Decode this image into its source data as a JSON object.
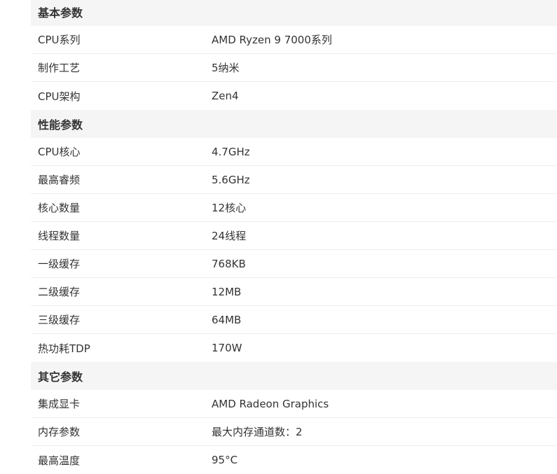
{
  "sections": [
    {
      "title": "基本参数",
      "rows": [
        {
          "label": "CPU系列",
          "value": "AMD Ryzen 9 7000系列"
        },
        {
          "label": "制作工艺",
          "value": "5纳米"
        },
        {
          "label": "CPU架构",
          "value": "Zen4"
        }
      ]
    },
    {
      "title": "性能参数",
      "rows": [
        {
          "label": "CPU核心",
          "value": "4.7GHz"
        },
        {
          "label": "最高睿频",
          "value": "5.6GHz"
        },
        {
          "label": "核心数量",
          "value": "12核心"
        },
        {
          "label": "线程数量",
          "value": "24线程"
        },
        {
          "label": "一级缓存",
          "value": "768KB"
        },
        {
          "label": "二级缓存",
          "value": "12MB"
        },
        {
          "label": "三级缓存",
          "value": "64MB"
        },
        {
          "label": "热功耗TDP",
          "value": "170W"
        }
      ]
    },
    {
      "title": "其它参数",
      "rows": [
        {
          "label": "集成显卡",
          "value": "AMD Radeon Graphics"
        },
        {
          "label": "内存参数",
          "value": "最大内存通道数：2"
        },
        {
          "label": "最高温度",
          "value": "95°C"
        }
      ]
    }
  ]
}
